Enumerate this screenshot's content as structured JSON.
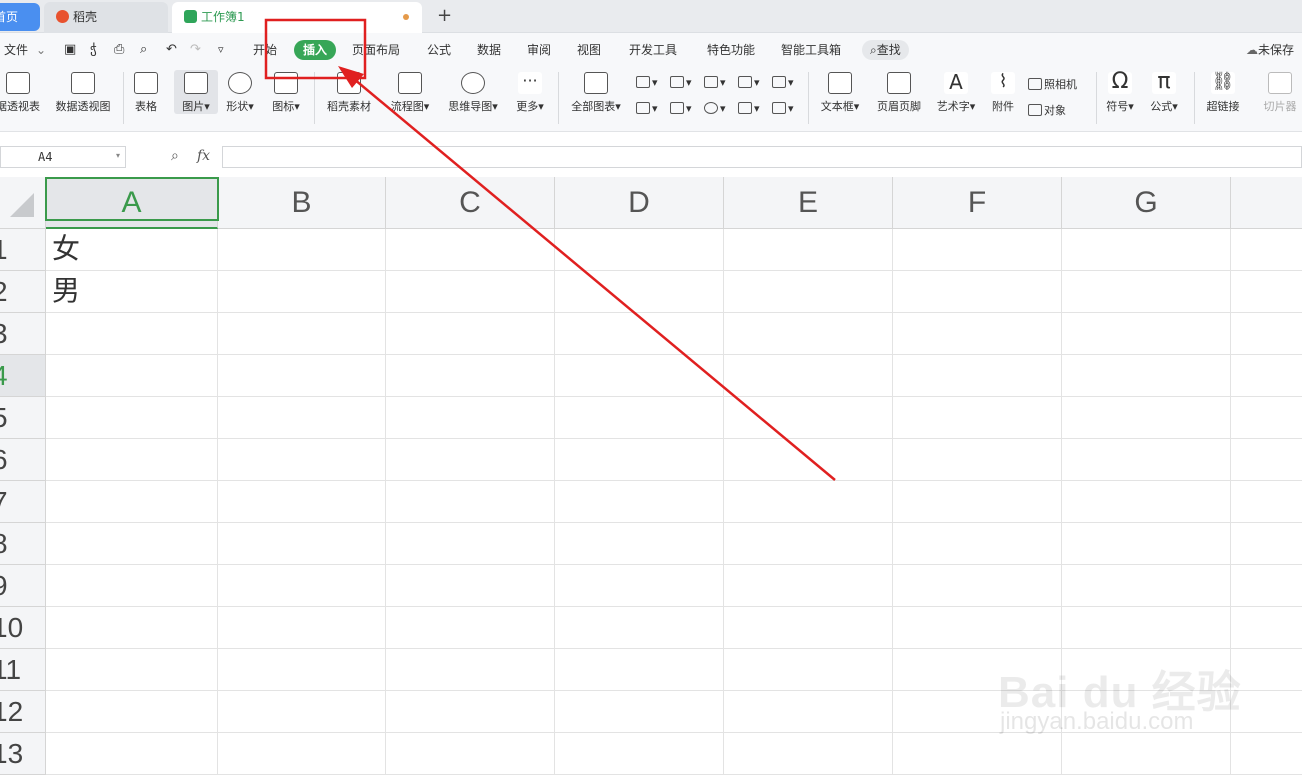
{
  "tabs": {
    "home": "首页",
    "daoke": "稻壳",
    "workbook": "工作簿1",
    "new": "+"
  },
  "menu": {
    "file": "文件",
    "items": [
      "开始",
      "插入",
      "页面布局",
      "公式",
      "数据",
      "审阅",
      "视图",
      "开发工具",
      "特色功能",
      "智能工具箱"
    ],
    "search": "查找",
    "unsaved": "未保存"
  },
  "ribbon": {
    "big": [
      "据透视表",
      "数据透视图",
      "表格",
      "图片",
      "形状",
      "图标",
      "稻壳素材",
      "流程图",
      "思维导图",
      "更多",
      "全部图表",
      "文本框",
      "页眉页脚",
      "艺术字",
      "附件",
      "符号",
      "公式",
      "超链接",
      "切片器"
    ],
    "small": {
      "camera": "照相机",
      "object": "对象"
    }
  },
  "formula": {
    "cell_ref": "A4",
    "fx": "fx",
    "value": ""
  },
  "sheet": {
    "columns": [
      "A",
      "B",
      "C",
      "D",
      "E",
      "F",
      "G"
    ],
    "rows": [
      "1",
      "2",
      "3",
      "4",
      "5",
      "6",
      "7",
      "8",
      "9",
      "10",
      "11",
      "12",
      "13"
    ],
    "cells": {
      "A1": "女",
      "A2": "男"
    },
    "active_cell": "A4",
    "active_col": "A"
  },
  "annotation": {
    "color": "#e02020"
  },
  "watermark": {
    "brand": "Bai du 经验",
    "url": "jingyan.baidu.com"
  }
}
